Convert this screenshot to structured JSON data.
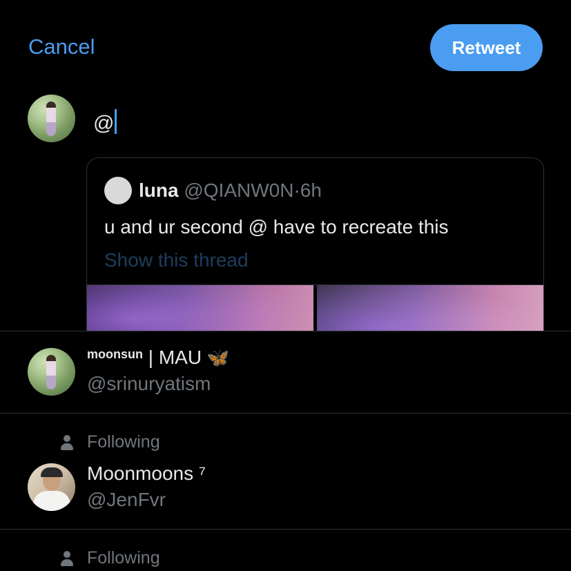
{
  "header": {
    "cancel_label": "Cancel",
    "retweet_label": "Retweet"
  },
  "compose": {
    "text": "@"
  },
  "quoted_tweet": {
    "name": "luna",
    "handle": "@QIANW0N",
    "separator": "·",
    "time": "6h",
    "text": "u and ur second @ have to recreate this",
    "show_thread": "Show this thread"
  },
  "mentions": [
    {
      "name_small": "moonsun",
      "name": " | MAU ",
      "badge": "🦋",
      "handle": "@srinuryatism"
    },
    {
      "context": "Following",
      "name": "Moonmoons ⁷",
      "handle": "@JenFvr"
    },
    {
      "context": "Following"
    }
  ],
  "colors": {
    "accent": "#4a9df0",
    "background": "#000000",
    "secondary_text": "#71767b",
    "divider": "#2f3336"
  }
}
